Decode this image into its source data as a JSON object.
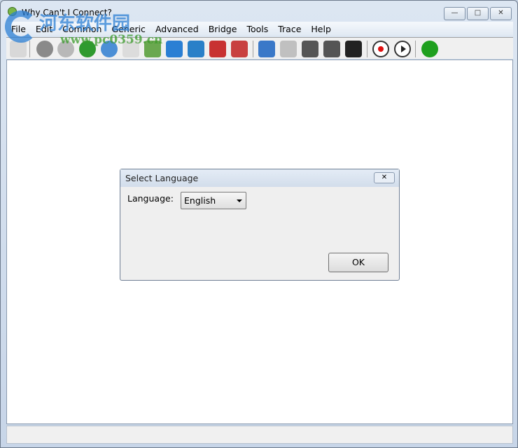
{
  "window": {
    "title": "Why Can't I Connect?",
    "minimize": "—",
    "maximize": "□",
    "close": "✕"
  },
  "menu": [
    "File",
    "Edit",
    "Common",
    "Generic",
    "Advanced",
    "Bridge",
    "Tools",
    "Trace",
    "Help"
  ],
  "toolbar": [
    {
      "icon": "copy-icon",
      "color": "#d8d8d8"
    },
    {
      "icon": "database-help-icon",
      "color": "#8a8a8a"
    },
    {
      "icon": "database-help-gray-icon",
      "color": "#b8b8b8"
    },
    {
      "icon": "globe-green-icon",
      "color": "#2f9a2f"
    },
    {
      "icon": "globe-network-icon",
      "color": "#4b8fd6"
    },
    {
      "icon": "mail-icon",
      "color": "#dcdcdc"
    },
    {
      "icon": "download-icon",
      "color": "#6aa84f"
    },
    {
      "icon": "mail-send-icon",
      "color": "#2a7fd4"
    },
    {
      "icon": "puzzle-add-icon",
      "color": "#2a80c8"
    },
    {
      "icon": "users-add-icon",
      "color": "#c83232"
    },
    {
      "icon": "books-icon",
      "color": "#c84040"
    },
    {
      "icon": "computer-network-icon",
      "color": "#3a78c8"
    },
    {
      "icon": "server-network-icon",
      "color": "#c0c0c0"
    },
    {
      "icon": "step-forward-icon",
      "color": "#555555"
    },
    {
      "icon": "step-end-icon",
      "color": "#555555"
    },
    {
      "icon": "stop-icon",
      "color": "#222222"
    },
    {
      "icon": "record-icon",
      "color": "#e01010"
    },
    {
      "icon": "play-icon",
      "color": "#222222"
    },
    {
      "icon": "radar-icon",
      "color": "#1fa01f"
    }
  ],
  "watermark": {
    "cn": "河东软件园",
    "url": "www.pc0359.cn"
  },
  "dialog": {
    "title": "Select Language",
    "close": "✕",
    "language_label": "Language:",
    "language_value": "English",
    "ok_label": "OK"
  }
}
